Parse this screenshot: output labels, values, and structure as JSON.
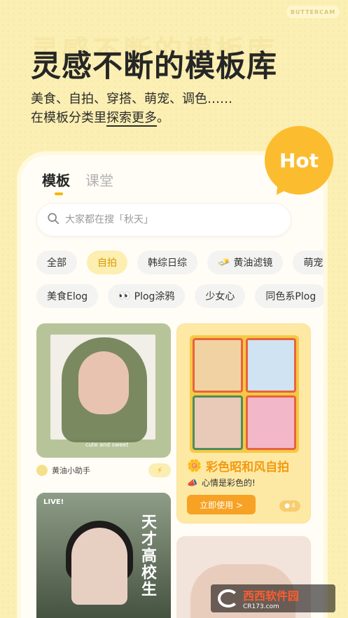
{
  "brand": "BUTTERCAM",
  "hero": {
    "ghost": "灵感不断的模板库",
    "title": "灵感不断的模板库",
    "subtitle_line1": "美食、自拍、穿搭、萌宠、调色……",
    "subtitle_line2_pre": "在模板分类里",
    "subtitle_line2_underline": "探索更多",
    "subtitle_line2_post": "。"
  },
  "hot_badge": "Hot",
  "tabs": [
    {
      "label": "模板",
      "active": true
    },
    {
      "label": "课堂",
      "active": false
    }
  ],
  "search": {
    "placeholder": "大家都在搜「秋天」",
    "icon": "search-icon"
  },
  "chips_row1": [
    {
      "label": "全部",
      "active": false
    },
    {
      "label": "自拍",
      "active": true
    },
    {
      "label": "韩综日综",
      "active": false
    },
    {
      "label": "黄油滤镜",
      "active": false,
      "emoji": "🧈"
    },
    {
      "label": "萌宠",
      "active": false
    }
  ],
  "chips_row2": [
    {
      "label": "美食Elog",
      "active": false
    },
    {
      "label": "Plog涂鸦",
      "active": false,
      "emoji": "👀"
    },
    {
      "label": "少女心",
      "active": false
    },
    {
      "label": "同色系Plog",
      "active": false
    }
  ],
  "cards": {
    "card1": {
      "caption": "cute and sweet",
      "author": "黄油小助手",
      "action_icon": "bolt-icon"
    },
    "card2": {
      "title": "彩色昭和风自拍",
      "title_icon": "sunflower-icon",
      "subtitle": "心情是彩色的!",
      "subtitle_icon": "megaphone-icon",
      "button": "立即使用 >",
      "count": "4"
    },
    "card3": {
      "live": "LIVE!",
      "big_text": "天才高校生"
    },
    "card4": {}
  },
  "watermark": {
    "name": "西西软件园",
    "site": "CR173.com"
  },
  "colors": {
    "accent": "#f5b80f",
    "background": "#fbefb3",
    "hot": "#fbbd2f",
    "button": "#f7a224"
  }
}
